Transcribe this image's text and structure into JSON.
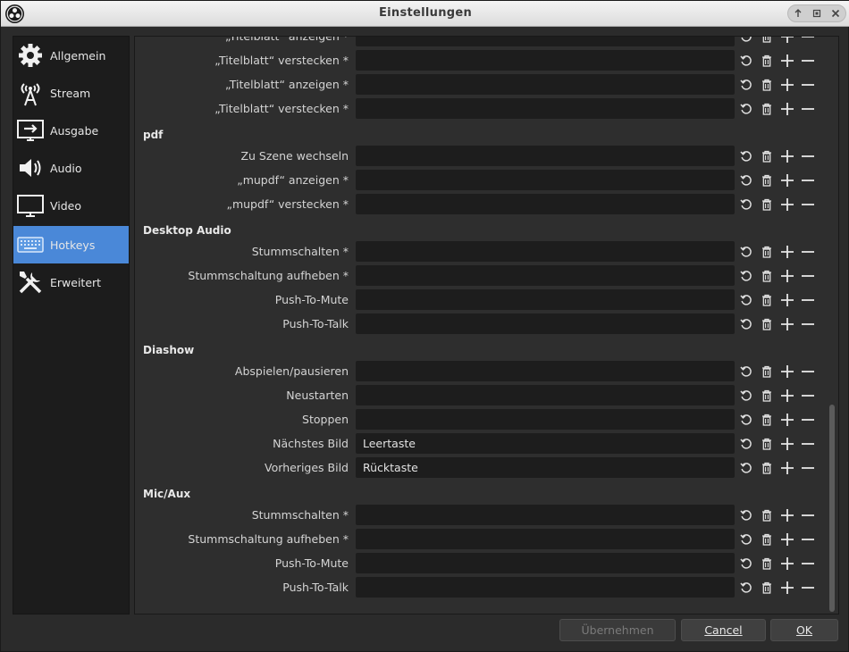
{
  "window": {
    "title": "Einstellungen"
  },
  "sidebar": {
    "items": [
      {
        "label": "Allgemein",
        "icon": "gear-icon"
      },
      {
        "label": "Stream",
        "icon": "antenna-icon"
      },
      {
        "label": "Ausgabe",
        "icon": "monitor-output-icon"
      },
      {
        "label": "Audio",
        "icon": "speaker-icon"
      },
      {
        "label": "Video",
        "icon": "monitor-icon"
      },
      {
        "label": "Hotkeys",
        "icon": "keyboard-icon",
        "active": true
      },
      {
        "label": "Erweitert",
        "icon": "tools-icon"
      }
    ]
  },
  "hotkeys": {
    "top_rows": [
      {
        "label": "„Titelblatt“ anzeigen *",
        "value": ""
      },
      {
        "label": "„Titelblatt“ verstecken *",
        "value": ""
      },
      {
        "label": "„Titelblatt“ anzeigen *",
        "value": ""
      },
      {
        "label": "„Titelblatt“ verstecken *",
        "value": ""
      }
    ],
    "groups": [
      {
        "title": "pdf",
        "rows": [
          {
            "label": "Zu Szene wechseln",
            "value": ""
          },
          {
            "label": "„mupdf“ anzeigen *",
            "value": ""
          },
          {
            "label": "„mupdf“ verstecken *",
            "value": ""
          }
        ]
      },
      {
        "title": "Desktop Audio",
        "rows": [
          {
            "label": "Stummschalten *",
            "value": ""
          },
          {
            "label": "Stummschaltung aufheben *",
            "value": ""
          },
          {
            "label": "Push-To-Mute",
            "value": ""
          },
          {
            "label": "Push-To-Talk",
            "value": ""
          }
        ]
      },
      {
        "title": "Diashow",
        "rows": [
          {
            "label": "Abspielen/pausieren",
            "value": ""
          },
          {
            "label": "Neustarten",
            "value": ""
          },
          {
            "label": "Stoppen",
            "value": ""
          },
          {
            "label": "Nächstes Bild",
            "value": "Leertaste"
          },
          {
            "label": "Vorheriges Bild",
            "value": "Rücktaste"
          }
        ]
      },
      {
        "title": "Mic/Aux",
        "rows": [
          {
            "label": "Stummschalten *",
            "value": ""
          },
          {
            "label": "Stummschaltung aufheben *",
            "value": ""
          },
          {
            "label": "Push-To-Mute",
            "value": ""
          },
          {
            "label": "Push-To-Talk",
            "value": ""
          }
        ]
      }
    ]
  },
  "buttons": {
    "apply": "Übernehmen",
    "cancel": "Cancel",
    "ok": "OK"
  },
  "colors": {
    "accent": "#4a88d8",
    "field": "#1d1d1d",
    "sidebar": "#1c1c1c",
    "background": "#2b2b2b"
  }
}
